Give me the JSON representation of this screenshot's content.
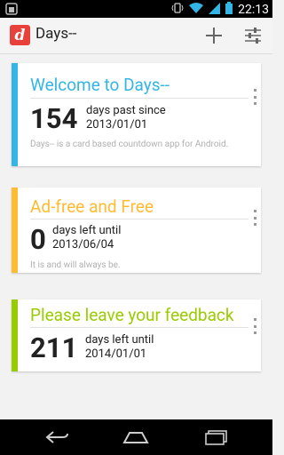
{
  "status_bar": {
    "time": "22:13"
  },
  "action_bar": {
    "logo_text": "d",
    "title": "Days--",
    "add_icon": "plus-icon",
    "settings_icon": "sliders-icon"
  },
  "colors": {
    "blue": "#33b5e5",
    "orange": "#ffbb33",
    "green": "#99cc00"
  },
  "cards": [
    {
      "title": "Welcome to Days--",
      "number": "154",
      "desc_line1": "days past since",
      "desc_line2": "2013/01/01",
      "subtext": "Days-- is a card based countdown app for Android."
    },
    {
      "title": "Ad-free and Free",
      "number": "0",
      "desc_line1": "days left until",
      "desc_line2": "2013/06/04",
      "subtext": "It is and will always be."
    },
    {
      "title": "Please leave your feedback",
      "number": "211",
      "desc_line1": "days left until",
      "desc_line2": "2014/01/01",
      "subtext": ""
    }
  ],
  "nav_bar": {
    "back_icon": "back-icon",
    "home_icon": "home-icon",
    "recents_icon": "recents-icon"
  }
}
